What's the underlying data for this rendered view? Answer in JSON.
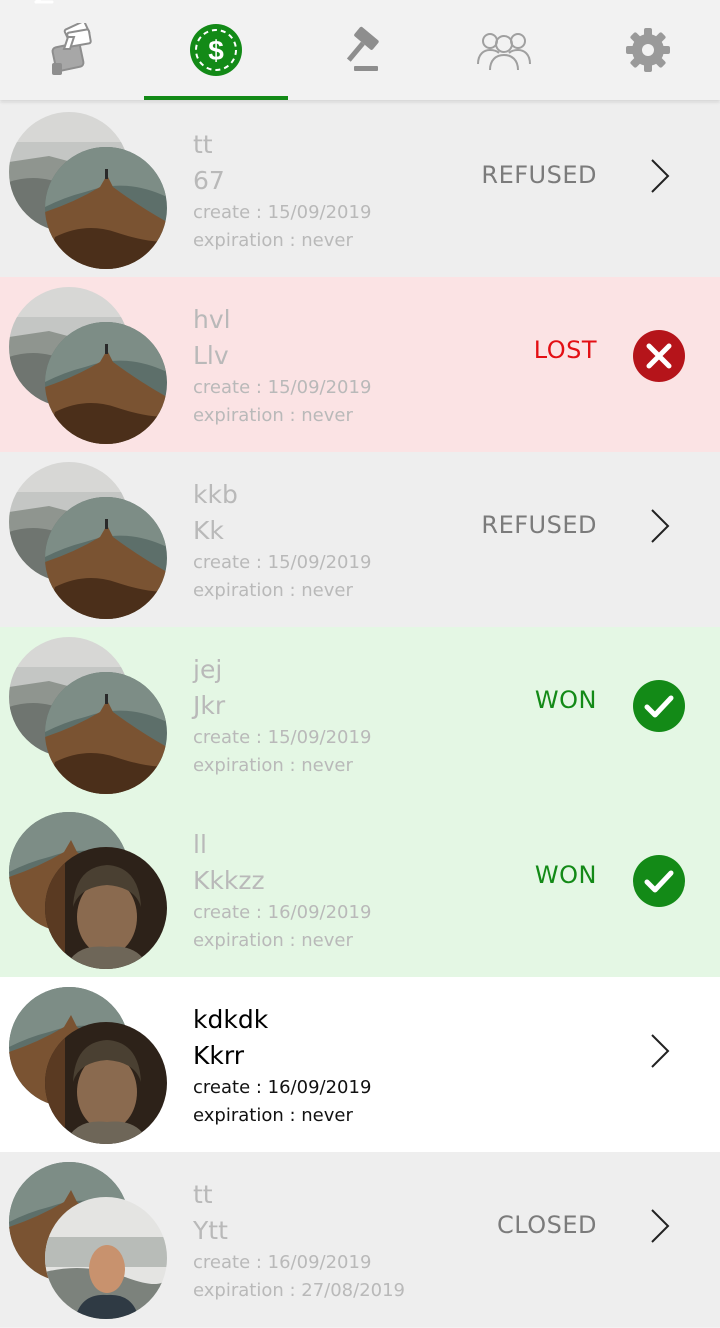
{
  "tabs": [
    {
      "id": "bets",
      "icon": "hand-money-icon"
    },
    {
      "id": "money",
      "icon": "dollar-coin-icon",
      "active": true
    },
    {
      "id": "judge",
      "icon": "gavel-icon"
    },
    {
      "id": "friends",
      "icon": "group-icon"
    },
    {
      "id": "settings",
      "icon": "gear-icon"
    }
  ],
  "colors": {
    "accent": "#138a17",
    "won": "#138a17",
    "lost": "#e30f14",
    "won_bg": "#e4f7e4",
    "lost_bg": "#fbe3e4",
    "neutral_bg": "#eeeeee"
  },
  "bets": [
    {
      "title": "tt",
      "subtitle": "67",
      "created": "create : 15/09/2019",
      "expiration": "expiration : never",
      "status": "REFUSED",
      "state": "refused",
      "action_icon": "chevron-right-icon"
    },
    {
      "title": "hvl",
      "subtitle": "Llv",
      "created": "create : 15/09/2019",
      "expiration": "expiration : never",
      "status": "LOST",
      "state": "lost",
      "action_icon": "close-circle-icon"
    },
    {
      "title": "kkb",
      "subtitle": "Kk",
      "created": "create : 15/09/2019",
      "expiration": "expiration : never",
      "status": "REFUSED",
      "state": "refused",
      "action_icon": "chevron-right-icon"
    },
    {
      "title": "jej",
      "subtitle": "Jkr",
      "created": "create : 15/09/2019",
      "expiration": "expiration : never",
      "status": "WON",
      "state": "won",
      "action_icon": "check-circle-icon"
    },
    {
      "title": "ll",
      "subtitle": "Kkkzz",
      "created": "create : 16/09/2019",
      "expiration": "expiration : never",
      "status": "WON",
      "state": "won",
      "action_icon": "check-circle-icon"
    },
    {
      "title": "kdkdk",
      "subtitle": "Kkrr",
      "created": "create : 16/09/2019",
      "expiration": "expiration : never",
      "status": "",
      "state": "open",
      "action_icon": "chevron-right-icon"
    },
    {
      "title": "tt",
      "subtitle": "Ytt",
      "created": "create : 16/09/2019",
      "expiration": "expiration : 27/08/2019",
      "status": "CLOSED",
      "state": "closed",
      "action_icon": "chevron-right-icon"
    }
  ]
}
